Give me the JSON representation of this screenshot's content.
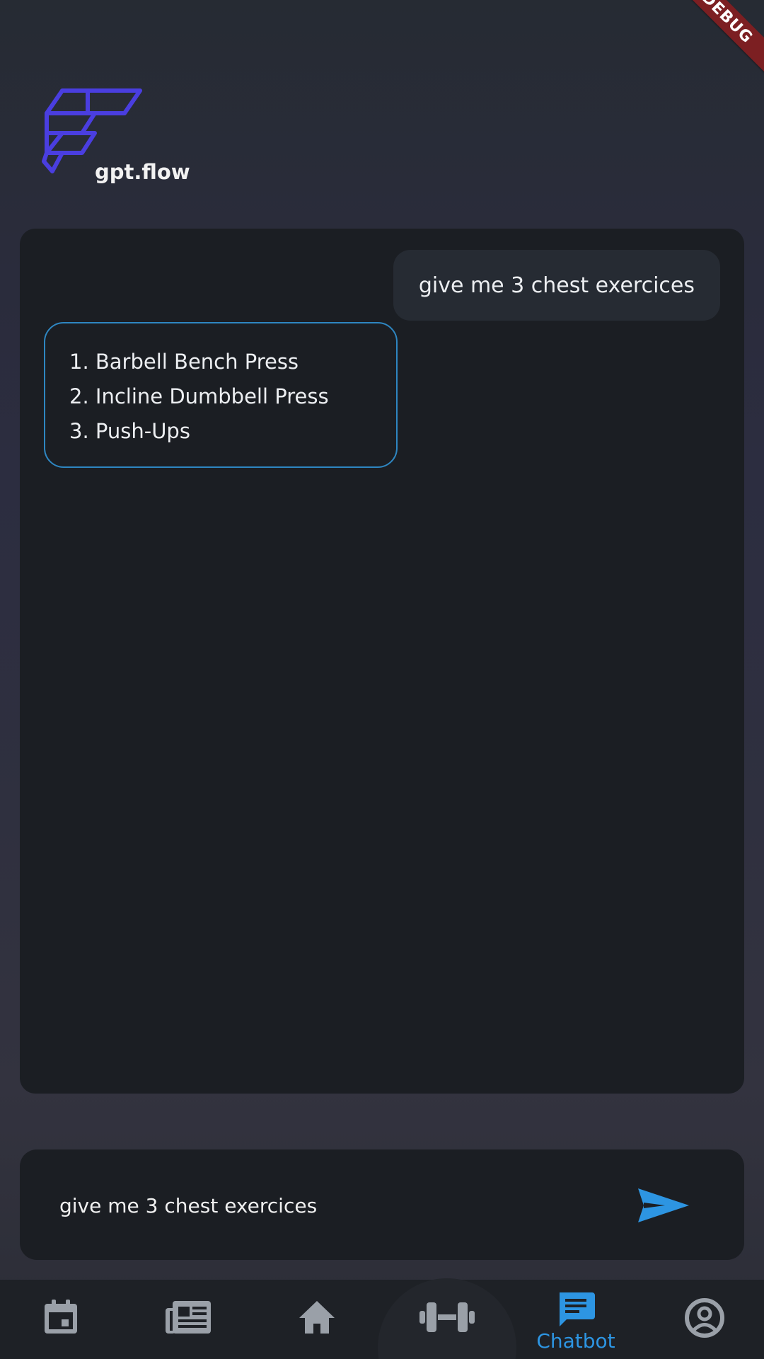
{
  "debug_banner": "DEBUG",
  "brand": {
    "name": "gpt.flow",
    "logo_icon": "flow-logo-icon",
    "logo_color": "#4a3ee0"
  },
  "chat": {
    "messages": [
      {
        "role": "user",
        "text": "give me 3 chest exercices"
      },
      {
        "role": "bot",
        "lines": [
          "1. Barbell Bench Press",
          "2. Incline Dumbbell Press",
          "3. Push-Ups"
        ]
      }
    ]
  },
  "input": {
    "value": "give me 3 chest exercices",
    "send_icon": "send-icon"
  },
  "nav": {
    "items": [
      {
        "icon": "calendar-icon",
        "label": ""
      },
      {
        "icon": "newspaper-icon",
        "label": ""
      },
      {
        "icon": "home-icon",
        "label": ""
      },
      {
        "icon": "dumbbell-icon",
        "label": ""
      },
      {
        "icon": "chat-icon",
        "label": "Chatbot",
        "active": true
      },
      {
        "icon": "account-icon",
        "label": ""
      }
    ]
  },
  "colors": {
    "accent": "#2d95e2",
    "inactive_icon": "#9aa0a8",
    "bot_border": "#2e86c1",
    "debug_ribbon": "#7c1f22"
  }
}
